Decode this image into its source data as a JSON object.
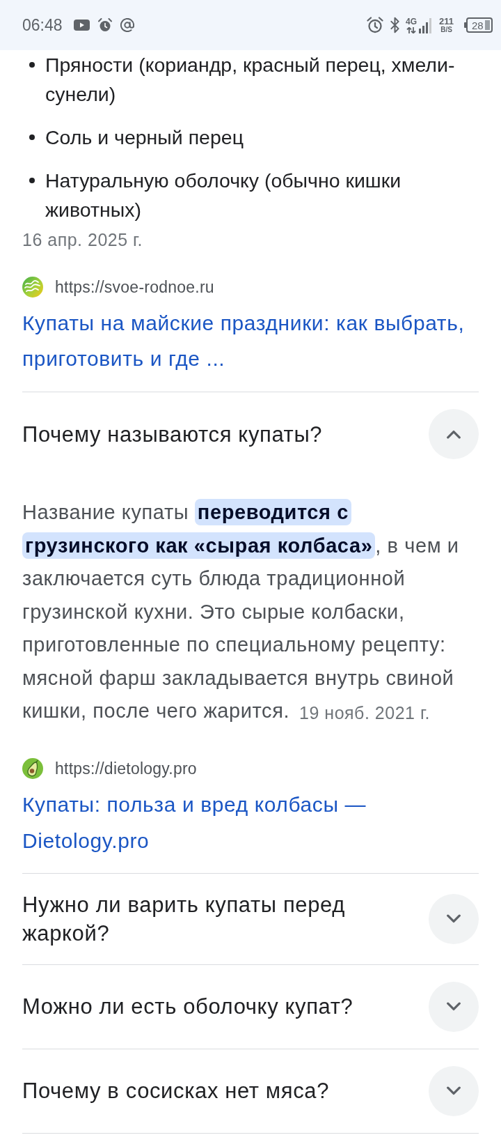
{
  "status_bar": {
    "time": "06:48",
    "network": "4G",
    "speed": "211",
    "speed_unit": "B/S",
    "battery": "28"
  },
  "previous_answer": {
    "bullets": [
      "Пряности (кориандр, красный перец, хмели-сунели)",
      "Соль и черный перец",
      "Натуральную оболочку (обычно кишки животных)"
    ],
    "date": "16 апр. 2025 г.",
    "source": {
      "url": "https://svoe-rodnoe.ru",
      "title": "Купаты на майские праздники: как выбрать, приготовить и где ..."
    }
  },
  "questions": [
    {
      "question": "Почему называются купаты?",
      "expanded": true,
      "answer": "Название купаты **переводится с грузинского как «сырая колбаса»**, в чем и заключается суть блюда традиционной грузинской кухни. Это сырые колбаски, приготовленные по специальному рецепту: мясной фарш закладывается внутрь свиной кишки, после чего жарится.",
      "date": "19 нояб. 2021 г.",
      "source": {
        "url": "https://dietology.pro",
        "title": "Купаты: польза и вред колбасы — Dietology.pro"
      }
    },
    {
      "question": "Нужно ли варить купаты перед жаркой?",
      "expanded": false
    },
    {
      "question": "Можно ли есть оболочку купат?",
      "expanded": false
    },
    {
      "question": "Почему в сосисках нет мяса?",
      "expanded": false
    }
  ]
}
